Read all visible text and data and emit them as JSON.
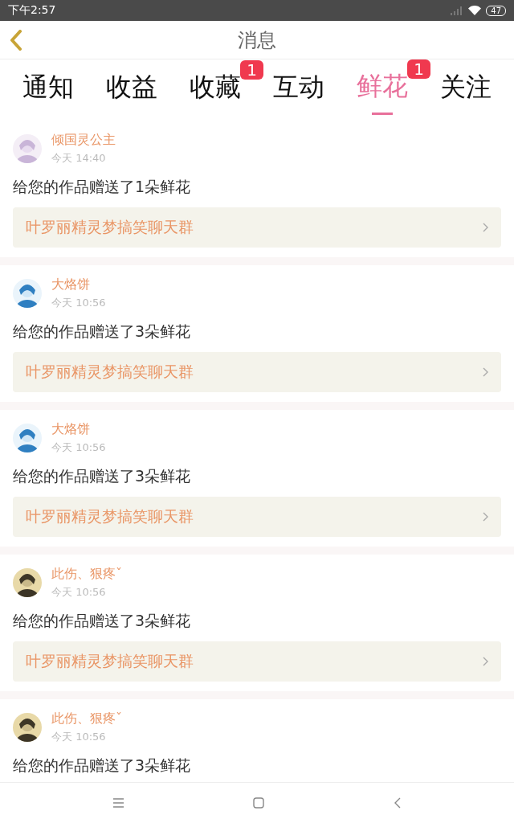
{
  "status_bar": {
    "time": "下午2:57",
    "battery": "47"
  },
  "header": {
    "title": "消息"
  },
  "tabs": [
    {
      "label": "通知",
      "selected": false
    },
    {
      "label": "收益",
      "selected": false
    },
    {
      "label": "收藏",
      "selected": false,
      "badge": "1"
    },
    {
      "label": "互动",
      "selected": false
    },
    {
      "label": "鲜花",
      "selected": true,
      "badge": "1"
    },
    {
      "label": "关注",
      "selected": false
    }
  ],
  "messages": [
    {
      "name": "倾国灵公主",
      "time": "今天 14:40",
      "text": "给您的作品赠送了1朵鲜花",
      "link": "叶罗丽精灵梦搞笑聊天群"
    },
    {
      "name": "大烙饼",
      "time": "今天 10:56",
      "text": "给您的作品赠送了3朵鲜花",
      "link": "叶罗丽精灵梦搞笑聊天群"
    },
    {
      "name": "大烙饼",
      "time": "今天 10:56",
      "text": "给您的作品赠送了3朵鲜花",
      "link": "叶罗丽精灵梦搞笑聊天群"
    },
    {
      "name": "此伤、狠疼ˇ",
      "time": "今天 10:56",
      "text": "给您的作品赠送了3朵鲜花",
      "link": "叶罗丽精灵梦搞笑聊天群"
    },
    {
      "name": "此伤、狠疼ˇ",
      "time": "今天 10:56",
      "text": "给您的作品赠送了3朵鲜花"
    }
  ]
}
